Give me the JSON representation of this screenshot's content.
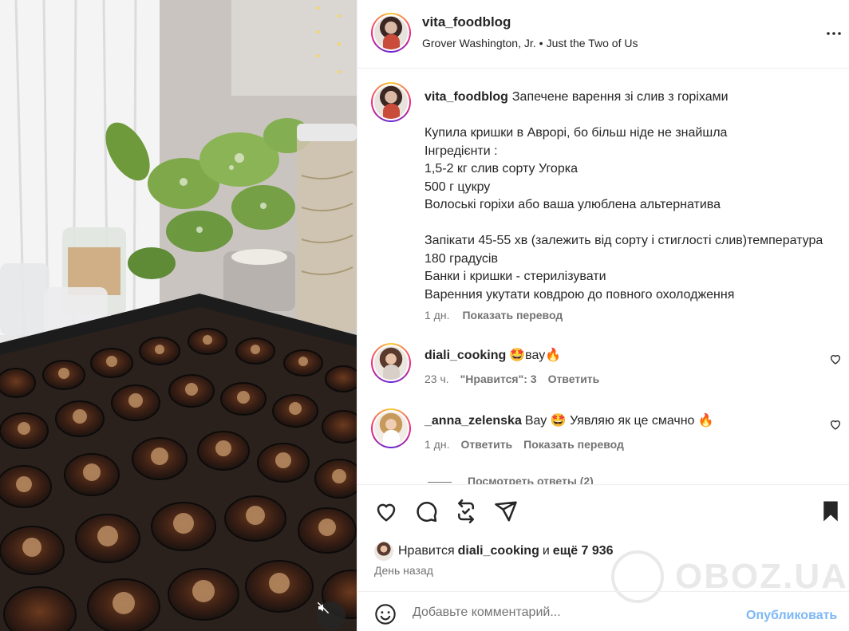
{
  "header": {
    "username": "vita_foodblog",
    "audio_artist": "Grover Washington, Jr.",
    "audio_separator": "•",
    "audio_track": "Just the Two of Us",
    "more_icon": "more-horizontal-icon"
  },
  "caption": {
    "username": "vita_foodblog",
    "text": "Запечене варення зі слив з горіхами\n\nКупила кришки в Аврорі, бо більш ніде не знайшла\nІнгредієнти :\n1,5-2 кг слив сорту Угорка\n500 г цукру\nВолоські горіхи або ваша улюблена альтернатива\n\nЗапікати 45-55 хв (залежить від сорту і стиглості слив)температура 180 градусів\nБанки і кришки - стерилізувати\nВаренния укутати ковдрою до повного охолодження",
    "time": "1 дн.",
    "translate": "Показать перевод"
  },
  "comments": [
    {
      "username": "diali_cooking",
      "text": "🤩вау🔥",
      "time": "23 ч.",
      "likes": "\"Нравится\": 3",
      "reply": "Ответить"
    },
    {
      "username": "_anna_zelenska",
      "text": "Вау 🤩 Уявляю як це смачно 🔥",
      "time": "1 дн.",
      "reply": "Ответить",
      "translate": "Показать перевод"
    }
  ],
  "view_replies": "Посмотреть ответы (2)",
  "actions": {
    "icons": [
      "heart-icon",
      "comment-icon",
      "repost-icon",
      "share-icon",
      "bookmark-icon"
    ],
    "likes_prefix": "Нравится",
    "likes_user": "diali_cooking",
    "likes_mid": "и",
    "likes_rest": "ещё 7 936",
    "date": "День назад"
  },
  "watermark": "OBOZ.UA",
  "add_comment": {
    "placeholder": "Добавьте комментарий...",
    "publish": "Опубликовать"
  },
  "colors": {
    "text": "#262626",
    "muted": "#737373",
    "publish_disabled": "#7cb7f5",
    "divider": "#efefef"
  }
}
